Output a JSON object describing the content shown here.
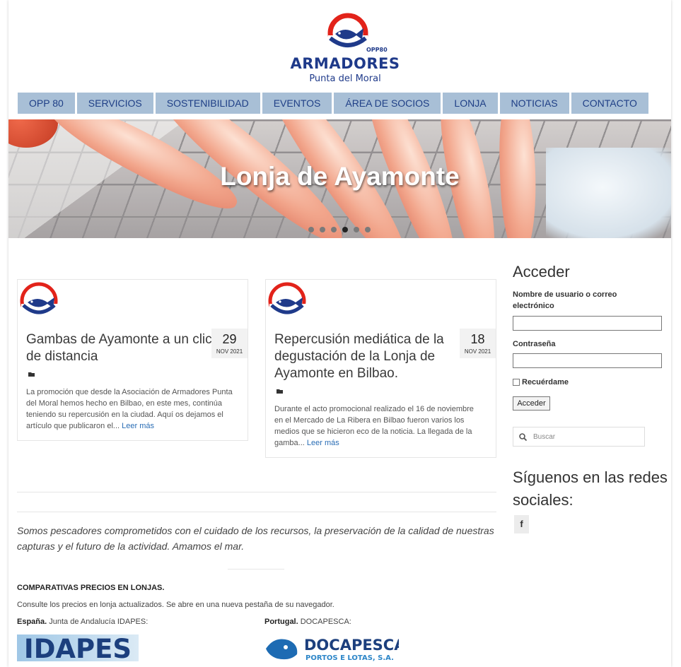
{
  "logo": {
    "main": "ARMADORES",
    "sub": "Punta del Moral",
    "opp": "OPP80"
  },
  "nav": [
    "OPP 80",
    "SERVICIOS",
    "SOSTENIBILIDAD",
    "EVENTOS",
    "ÁREA DE SOCIOS",
    "LONJA",
    "NOTICIAS",
    "CONTACTO"
  ],
  "banner": {
    "title": "Lonja de Ayamonte",
    "slides": 6,
    "active_slide": 4
  },
  "posts": [
    {
      "title_lines": [
        "Gambas de Ayamonte a un clic",
        "de distancia"
      ],
      "day": "29",
      "month": "NOV 2021",
      "excerpt_lines": [
        "La promoción que desde la Asociación de Armadores Punta",
        "del Moral hemos hecho en Bilbao, en este mes, continúa",
        "teniendo su repercusión en la ciudad. Aquí os dejamos el",
        "artículo que publicaron el..."
      ],
      "read_more": "Leer más"
    },
    {
      "title_lines": [
        "Repercusión mediática de la",
        "degustación de la Lonja de",
        "Ayamonte en Bilbao."
      ],
      "day": "18",
      "month": "NOV 2021",
      "excerpt_lines": [
        "Durante el acto promocional realizado el 16 de noviembre",
        "en el Mercado de La Ribera en Bilbao fueron varios los",
        "medios que se hicieron eco de la noticia. La llegada de la",
        "gamba..."
      ],
      "read_more": "Leer más"
    }
  ],
  "tagline_lines": [
    "Somos pescadores comprometidos con el cuidado de los recursos, la preservación de la calidad de nuestras",
    "capturas y el futuro de la actividad. Amamos el mar."
  ],
  "comparativas": {
    "heading": "COMPARATIVAS PRECIOS EN LONJAS.",
    "text": "Consulte los precios en lonja actualizados. Se abre en una nueva pestaña de su navegador.",
    "spain_bold": "España.",
    "spain_rest": " Junta de Andalucía IDAPES:",
    "portugal_bold": "Portugal.",
    "portugal_rest": " DOCAPESCA:",
    "idapes_logo": "IDAPES",
    "docapesca_logo": "DOCAPESCA",
    "docapesca_sub": "PORTOS E LOTAS, S.A."
  },
  "sidebar": {
    "login_title": "Acceder",
    "user_label_lines": [
      "Nombre de usuario o correo",
      "electrónico"
    ],
    "password_label": "Contraseña",
    "remember": "Recuérdame",
    "login_button": "Acceder",
    "search_placeholder": "Buscar",
    "social_title_lines": [
      "Síguenos en las redes",
      "sociales:"
    ],
    "facebook": "f"
  },
  "colors": {
    "nav_bg": "#a8bfd6",
    "nav_text": "#1f3f86",
    "brand_blue": "#1f3a8a",
    "brand_red": "#e2231a",
    "link": "#2a6db5"
  }
}
